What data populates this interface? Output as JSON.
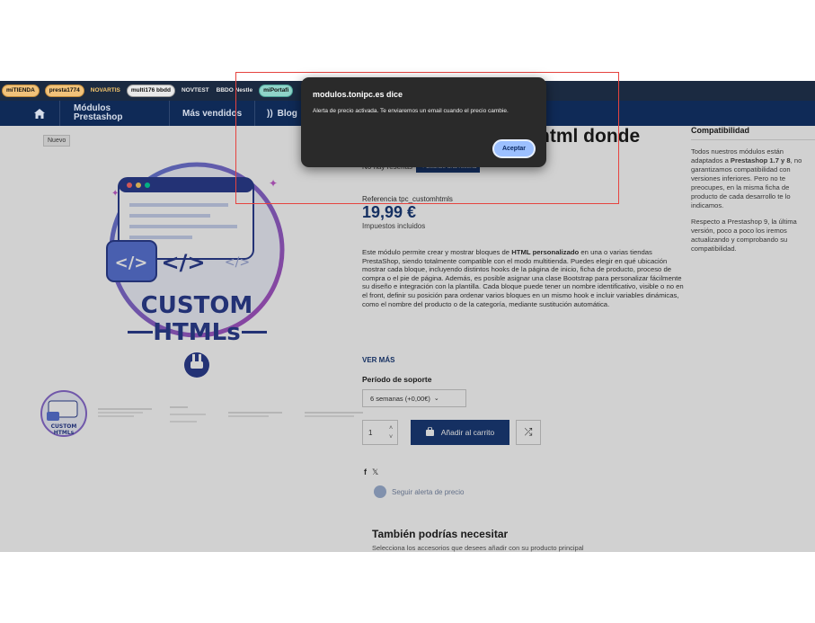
{
  "bookmarks": [
    "miTIENDA",
    "presta1774",
    "NOVARTIS",
    "multi176 bbdd",
    "NOVTEST",
    "BBDO Nestle",
    "miPortafi"
  ],
  "nav": {
    "modulos_line1": "Módulos",
    "modulos_line2": "Prestashop",
    "mas_vendidos": "Más vendidos",
    "blog": "Blog"
  },
  "product": {
    "badge": "Nuevo",
    "title_fragment": "ntml donde",
    "no_reviews": "No hay reseñas",
    "write_review": "Escribe una reseña",
    "reference": "Referencia tpc_customhtmls",
    "price": "19,99 €",
    "tax": "Impuestos incluidos",
    "description_parts": [
      "Este módulo permite crear y mostrar bloques de ",
      "HTML personalizado",
      " en una o varias tiendas PrestaShop, siendo totalmente compatible con el modo multitienda. Puedes elegir en qué ubicación mostrar cada bloque, incluyendo distintos hooks de la página de inicio, ficha de producto, proceso de compra o el pie de página. Además, es posible asignar una clase Bootstrap para personalizar fácilmente su diseño e integración con la plantilla. Cada bloque puede tener un nombre identificativo, visible o no en el front, definir su posición para ordenar varios bloques en un mismo hook e incluir variables dinámicas, como el nombre del producto o de la categoría, mediante sustitución automática."
    ],
    "ver_mas": "VER MÁS",
    "periodo_label": "Período de soporte",
    "periodo_value": "6 semanas (+0,00€)",
    "qty": "1",
    "add_to_cart": "Añadir al carrito",
    "social": [
      "f",
      "𝕏"
    ],
    "seguir_alerta": "Seguir alerta de precio",
    "tambien": "También podrías necesitar",
    "selecciona": "Selecciona los accesorios que desees añadir con su producto principal",
    "image_text_line1": "CUSTOM",
    "image_text_line2": "HTMLs",
    "thumb_text_line1": "CUSTOM",
    "thumb_text_line2": "HTMLs"
  },
  "compat": {
    "title": "Compatibilidad",
    "p1_a": "Todos nuestros módulos están adaptados a ",
    "p1_b": "Prestashop 1.7 y 8",
    "p1_c": ", no garantizamos compatibilidad con versiones inferiores. Pero no te preocupes, en la misma ficha de producto de cada desarrollo te lo indicamos.",
    "p2": "Respecto a Prestashop 9, la última versión, poco a poco los iremos actualizando y comprobando su compatibilidad."
  },
  "dialog": {
    "title": "modulos.tonipc.es dice",
    "message": "Alerta de precio activada. Te enviaremos un email cuando el precio cambie.",
    "button": "Aceptar"
  },
  "colors": {
    "navy": "#0f2a57",
    "accent": "#1a3b78",
    "dialog_bg": "#2a2a2a",
    "dialog_button": "#9cc0ff",
    "highlight_box": "#e6433f"
  }
}
